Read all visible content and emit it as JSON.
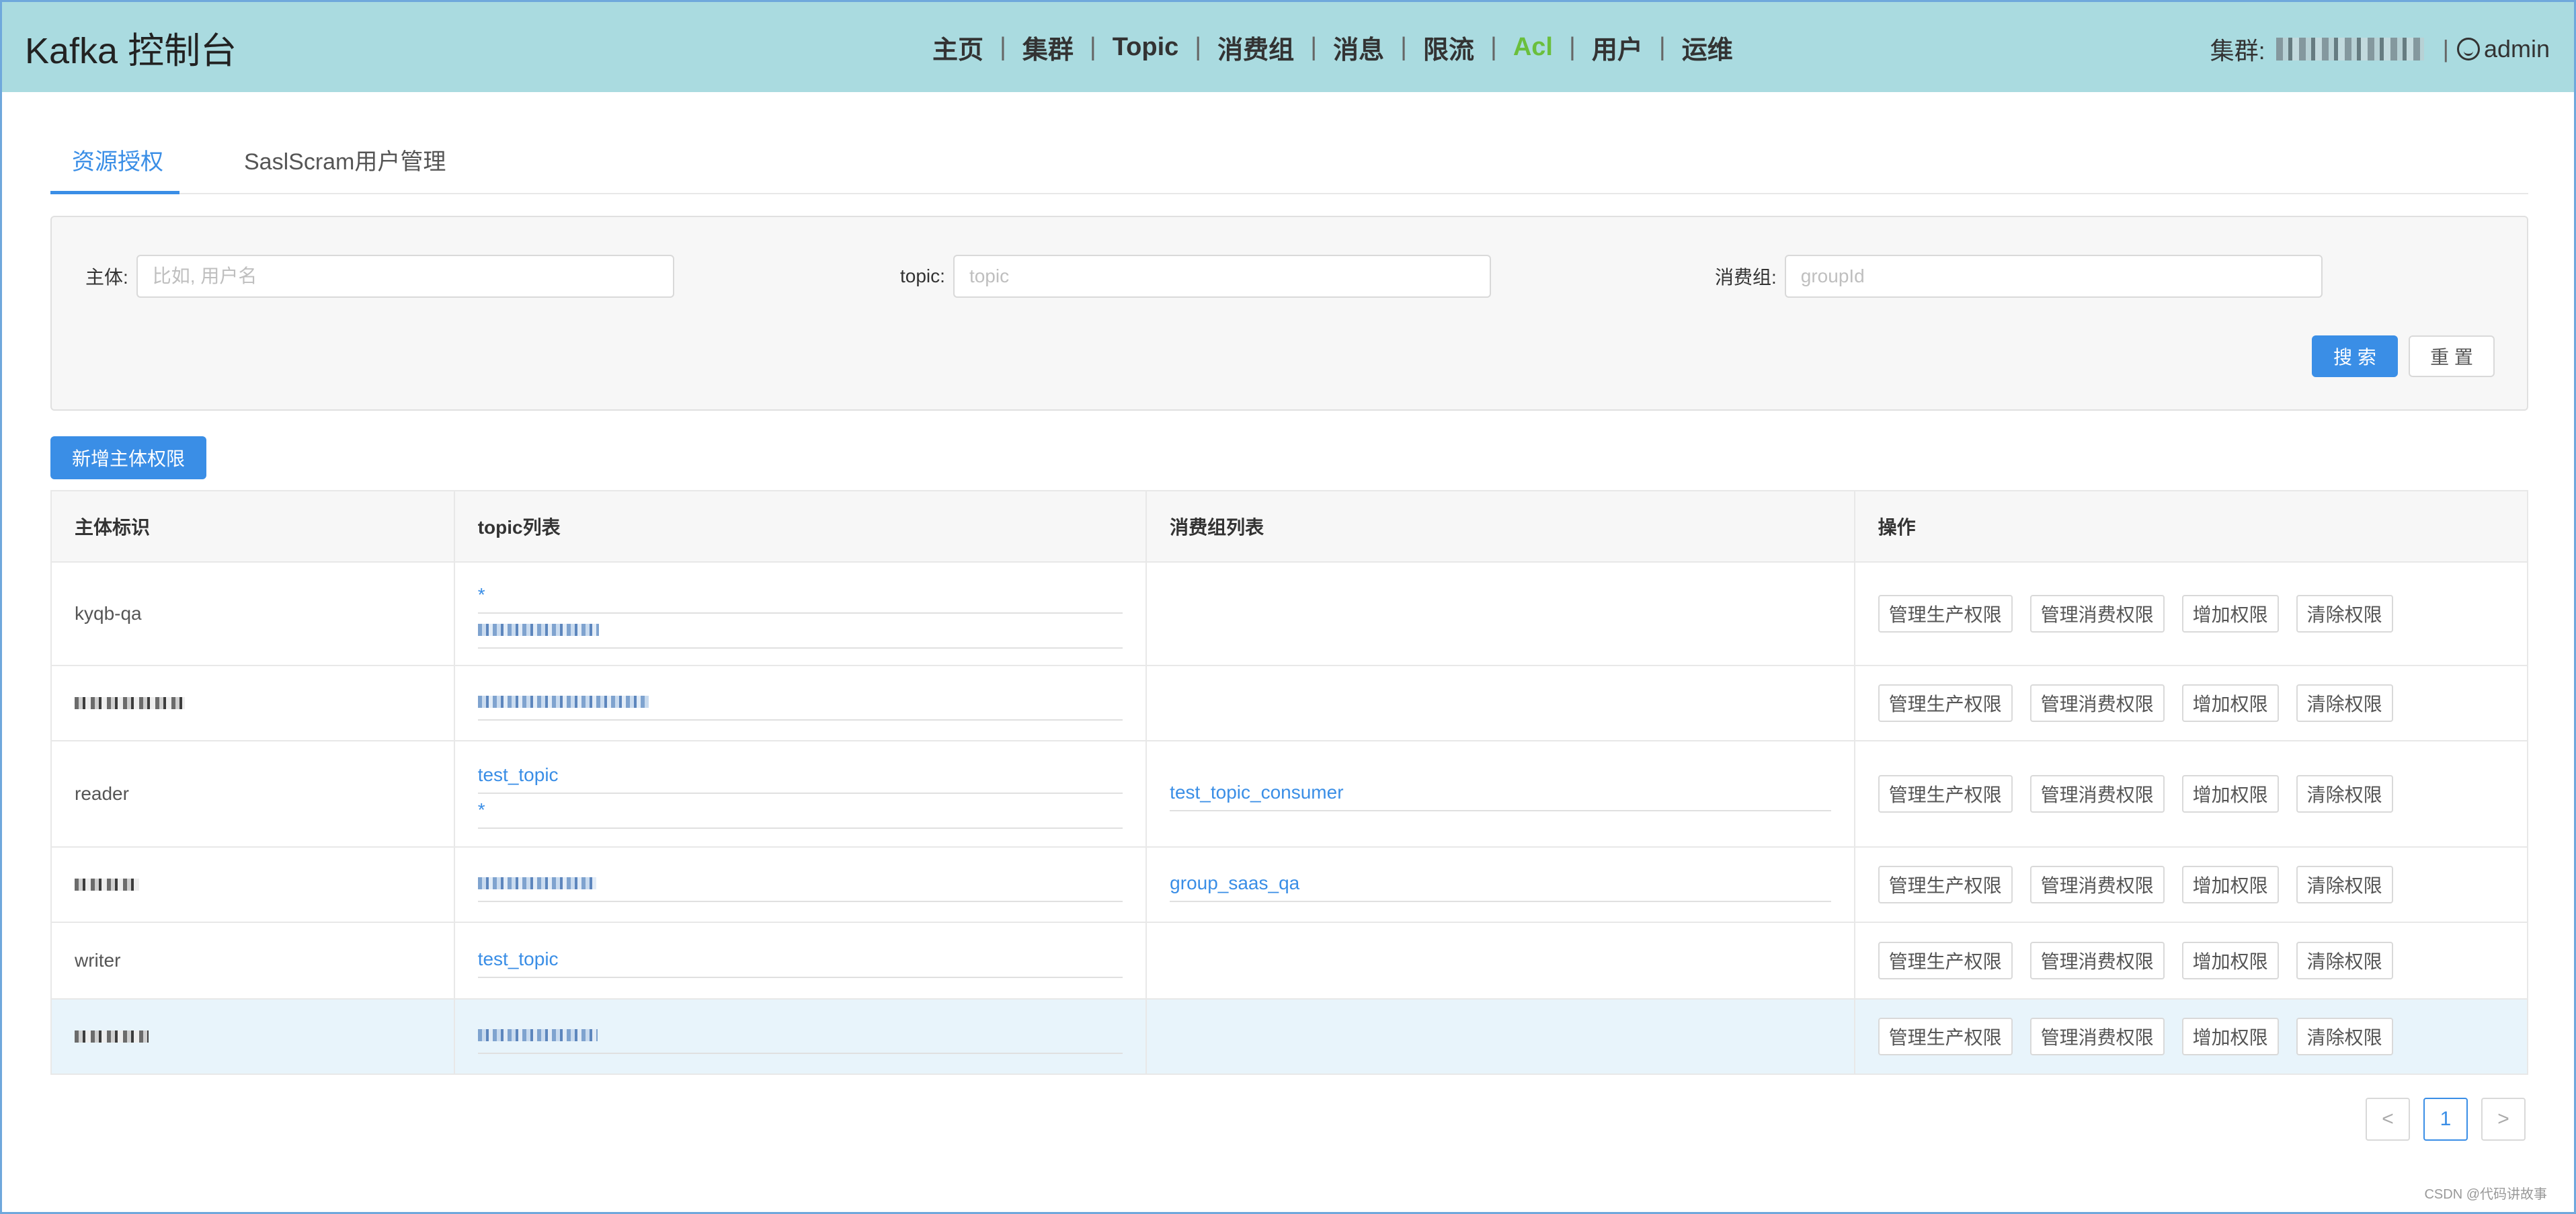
{
  "header": {
    "brand": "Kafka 控制台",
    "nav": [
      {
        "label": "主页",
        "active": false
      },
      {
        "label": "集群",
        "active": false
      },
      {
        "label": "Topic",
        "active": false
      },
      {
        "label": "消费组",
        "active": false
      },
      {
        "label": "消息",
        "active": false
      },
      {
        "label": "限流",
        "active": false
      },
      {
        "label": "Acl",
        "active": true
      },
      {
        "label": "用户",
        "active": false
      },
      {
        "label": "运维",
        "active": false
      }
    ],
    "cluster_label": "集群:",
    "username": "admin"
  },
  "tabs": [
    {
      "label": "资源授权",
      "active": true
    },
    {
      "label": "SaslScram用户管理",
      "active": false
    }
  ],
  "search": {
    "principal_label": "主体:",
    "principal_placeholder": "比如, 用户名",
    "topic_label": "topic:",
    "topic_placeholder": "topic",
    "group_label": "消费组:",
    "group_placeholder": "groupId",
    "search_button": "搜 索",
    "reset_button": "重 置"
  },
  "add_button": "新增主体权限",
  "table": {
    "columns": [
      "主体标识",
      "topic列表",
      "消费组列表",
      "操作"
    ],
    "actions": [
      "管理生产权限",
      "管理消费权限",
      "增加权限",
      "清除权限"
    ],
    "rows": [
      {
        "principal": "kyqb-qa",
        "topics": [
          "*",
          "[redacted]"
        ],
        "groups": []
      },
      {
        "principal": "[redacted]",
        "topics": [
          "[redacted]"
        ],
        "groups": []
      },
      {
        "principal": "reader",
        "topics": [
          "test_topic",
          "*"
        ],
        "groups": [
          "test_topic_consumer"
        ]
      },
      {
        "principal": "[redacted]",
        "topics": [
          "[redacted]"
        ],
        "groups": [
          "group_saas_qa"
        ]
      },
      {
        "principal": "writer",
        "topics": [
          "test_topic"
        ],
        "groups": []
      },
      {
        "principal": "[redacted]",
        "topics": [
          "[redacted]"
        ],
        "groups": []
      }
    ]
  },
  "pager": {
    "prev": "<",
    "current": "1",
    "next": ">"
  },
  "watermark": "CSDN @代码讲故事",
  "colors": {
    "header_bg": "#aadbe0",
    "primary": "#3a8ee6",
    "active_nav": "#6abf3c"
  }
}
